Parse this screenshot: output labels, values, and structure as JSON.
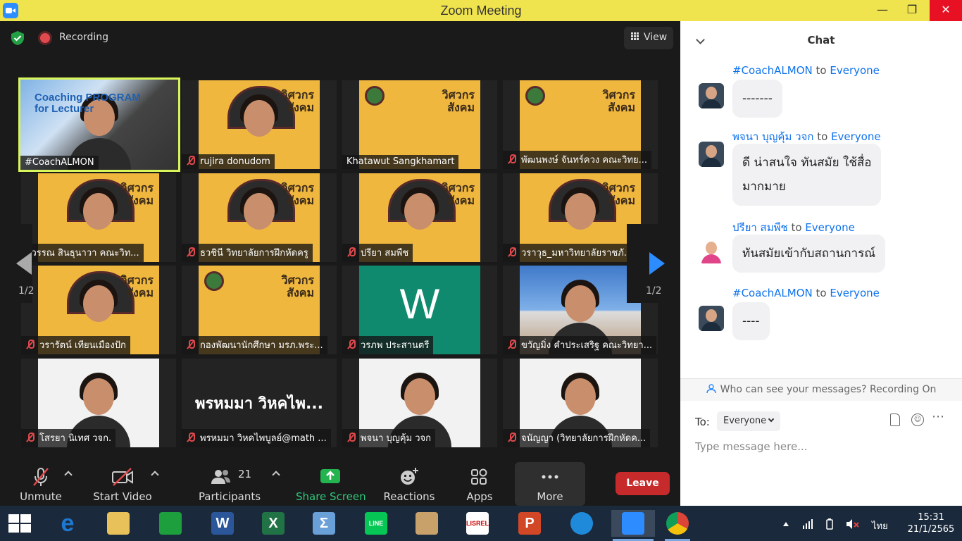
{
  "window": {
    "title": "Zoom Meeting"
  },
  "top": {
    "recording_label": "Recording",
    "view_label": "View"
  },
  "paging": {
    "left": "1/2",
    "right": "1/2"
  },
  "participants": [
    {
      "name": "#CoachALMON",
      "muted": false,
      "kind": "coach"
    },
    {
      "name": "rujira donudom",
      "muted": true,
      "kind": "poster-person"
    },
    {
      "name": "Khatawut Sangkhamart",
      "muted": false,
      "kind": "poster"
    },
    {
      "name": "พัฒนพงษ์ จันทร์ควง คณะวิทย...",
      "muted": true,
      "kind": "poster"
    },
    {
      "name": "ดิวรรณ สินธุนาวา คณะวิท...",
      "muted": false,
      "kind": "poster-person"
    },
    {
      "name": "ธวชินี วิทยาลัยการฝึกหัดครู",
      "muted": true,
      "kind": "poster-person"
    },
    {
      "name": "ปรียา สมพืช",
      "muted": true,
      "kind": "poster-person"
    },
    {
      "name": "วราวุธ_มหาวิทยาลัยราชภั...",
      "muted": true,
      "kind": "poster-person"
    },
    {
      "name": "วรารัตน์ เทียนเมืองปัก",
      "muted": true,
      "kind": "poster-person"
    },
    {
      "name": "กองพัฒนานักศึกษา มรภ.พระ...",
      "muted": true,
      "kind": "poster"
    },
    {
      "name": "วรภพ ประสานตรี",
      "muted": true,
      "kind": "green",
      "initial": "W"
    },
    {
      "name": "ขวัญมิ่ง คำประเสริฐ คณะวิทยา...",
      "muted": true,
      "kind": "sky"
    },
    {
      "name": "โสรยา นิเทศ วจก.",
      "muted": true,
      "kind": "white-person"
    },
    {
      "name": "พรหมมา วิหคไพบูลย์@math ...",
      "muted": true,
      "kind": "textonly",
      "display": "พรหมมา วิหคไพ..."
    },
    {
      "name": "พจนา บุญคุ้ม วจก",
      "muted": true,
      "kind": "white-person"
    },
    {
      "name": "จนัญญา (วิทยาลัยการฝึกหัดค...",
      "muted": true,
      "kind": "white-person"
    }
  ],
  "coach_banner": "Coaching PROGRAM\nfor Lecturer",
  "toolbar": {
    "unmute": "Unmute",
    "start_video": "Start Video",
    "participants": "Participants",
    "participants_count": "21",
    "share_screen": "Share Screen",
    "reactions": "Reactions",
    "apps": "Apps",
    "more": "More",
    "leave": "Leave"
  },
  "chat": {
    "title": "Chat",
    "to_word": "to",
    "messages": [
      {
        "sender": "#CoachALMON",
        "target": "Everyone",
        "text": "-------"
      },
      {
        "sender": "พจนา บุญคุ้ม วจก",
        "target": "Everyone",
        "text": "ดี น่าสนใจ ทันสมัย ใช้สื่อ\nมากมาย"
      },
      {
        "sender": "ปรียา สมพืช",
        "target": "Everyone",
        "text": "ทันสมัยเข้ากับสถานการณ์"
      },
      {
        "sender": "#CoachALMON",
        "target": "Everyone",
        "text": "----"
      }
    ],
    "privacy_notice": "Who can see your messages? Recording On",
    "to_label": "To:",
    "to_value": "Everyone",
    "input_placeholder": "Type message here..."
  },
  "taskbar": {
    "apps": [
      {
        "name": "internet-explorer",
        "letter": "e",
        "color": "#1e78d2"
      },
      {
        "name": "file-explorer",
        "letter": "",
        "color": "#e8c15a"
      },
      {
        "name": "store",
        "letter": "",
        "color": "#1c9f3c"
      },
      {
        "name": "word",
        "letter": "W",
        "color": "#2b579a"
      },
      {
        "name": "excel",
        "letter": "X",
        "color": "#217346"
      },
      {
        "name": "math-input",
        "letter": "Σ",
        "color": "#6aa0d8"
      },
      {
        "name": "line",
        "letter": "LINE",
        "color": "#06c755"
      },
      {
        "name": "paint",
        "letter": "",
        "color": "#c8a06a"
      },
      {
        "name": "lisrel",
        "letter": "LISREL",
        "color": "#ffffff"
      },
      {
        "name": "powerpoint",
        "letter": "P",
        "color": "#d24726"
      },
      {
        "name": "edge",
        "letter": "",
        "color": "#1f8ad9"
      },
      {
        "name": "zoom",
        "letter": "",
        "color": "#2d8cff"
      },
      {
        "name": "chrome",
        "letter": "",
        "color": "#db4437"
      }
    ],
    "language": "ไทย",
    "time": "15:31",
    "date": "21/1/2565"
  }
}
